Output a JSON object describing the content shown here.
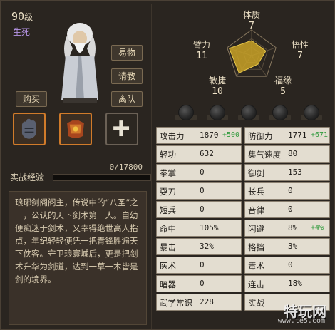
{
  "character": {
    "level": "90",
    "level_unit": "级",
    "realm": "生死",
    "description": "琅琊剑阁阁主，传说中的“八圣”之一，公认的天下剑术第一人。自幼便痴迷于剑术，又幸得绝世高人指点，年纪轻轻便凭一把青锋胜遍天下侠客。守卫琅寰城后，更是把剑术升华为剑道，达到一草一木皆是剑的境界。"
  },
  "buttons": {
    "trade": "易物",
    "ask": "请教",
    "buy": "购买",
    "leave_team": "离队"
  },
  "experience": {
    "label": "实战经验",
    "value": "0/17800",
    "fraction": 0
  },
  "attributes": {
    "constitution": {
      "label": "体质",
      "value": "7"
    },
    "strength": {
      "label": "臂力",
      "value": "11"
    },
    "comprehension": {
      "label": "悟性",
      "value": "7"
    },
    "agility": {
      "label": "敏捷",
      "value": "10"
    },
    "luck": {
      "label": "福缘",
      "value": "5"
    }
  },
  "stats": [
    {
      "name": "攻击力",
      "value": "1870",
      "bonus": "+500"
    },
    {
      "name": "防御力",
      "value": "1771",
      "bonus": "+671"
    },
    {
      "name": "轻功",
      "value": "632",
      "bonus": ""
    },
    {
      "name": "集气速度",
      "value": "80",
      "bonus": ""
    },
    {
      "name": "拳掌",
      "value": "0",
      "bonus": ""
    },
    {
      "name": "御剑",
      "value": "153",
      "bonus": ""
    },
    {
      "name": "耍刀",
      "value": "0",
      "bonus": ""
    },
    {
      "name": "长兵",
      "value": "0",
      "bonus": ""
    },
    {
      "name": "短兵",
      "value": "0",
      "bonus": ""
    },
    {
      "name": "音律",
      "value": "0",
      "bonus": ""
    },
    {
      "name": "命中",
      "value": "105%",
      "bonus": ""
    },
    {
      "name": "闪避",
      "value": "8%",
      "bonus": "+4%"
    },
    {
      "name": "暴击",
      "value": "32%",
      "bonus": ""
    },
    {
      "name": "格挡",
      "value": "3%",
      "bonus": ""
    },
    {
      "name": "医术",
      "value": "0",
      "bonus": ""
    },
    {
      "name": "毒术",
      "value": "0",
      "bonus": ""
    },
    {
      "name": "暗器",
      "value": "0",
      "bonus": ""
    },
    {
      "name": "连击",
      "value": "18%",
      "bonus": ""
    },
    {
      "name": "武学常识",
      "value": "228",
      "bonus": ""
    },
    {
      "name": "实战",
      "value": "",
      "bonus": ""
    }
  ],
  "watermark": {
    "big": "特玩网",
    "small": "www.te5.com"
  },
  "colors": {
    "realm": "#b694e6",
    "bonus": "#2d9a3a",
    "slot_border": "#d17b2a"
  }
}
